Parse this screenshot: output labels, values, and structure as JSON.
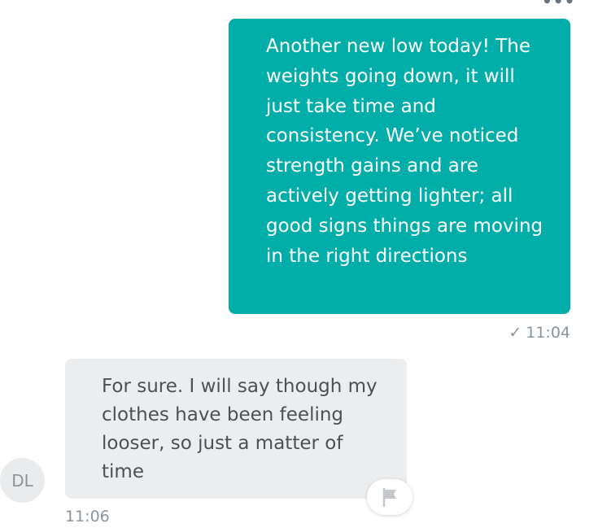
{
  "header": {
    "more_label": "•••"
  },
  "messages": [
    {
      "direction": "outgoing",
      "text": "Another new low today! The weights going down, it will just take time and consistency. We’ve noticed strength gains and are actively getting lighter; all good signs things are moving in the right directions",
      "status_icon": "✓",
      "time": "11:04",
      "color": "#00ada8"
    },
    {
      "direction": "incoming",
      "sender_initials": "DL",
      "text": "For sure. I will say though my clothes have been feeling looser, so just a matter of time",
      "time": "11:06",
      "color": "#ecedee"
    }
  ],
  "icons": {
    "more": "more-options-icon",
    "read_receipt": "checkmark-icon",
    "flag": "flag-icon"
  }
}
